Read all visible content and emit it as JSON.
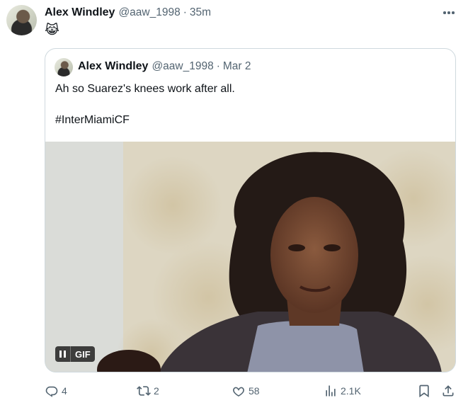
{
  "tweet": {
    "author_name": "Alex Windley",
    "handle": "@aaw_1998",
    "separator": "·",
    "time": "35m",
    "emoji": "😹",
    "quote": {
      "author_name": "Alex Windley",
      "handle": "@aaw_1998",
      "separator": "·",
      "time": "Mar 2",
      "text": "Ah so Suarez's knees work after all.",
      "hashtag": "#InterMiamiCF",
      "media_badge": "GIF"
    },
    "actions": {
      "replies": "4",
      "reposts": "2",
      "likes": "58",
      "views": "2.1K"
    }
  },
  "icons": {
    "more": "more-horizontal-icon",
    "reply": "reply-icon",
    "repost": "repost-icon",
    "like": "heart-icon",
    "views": "views-chart-icon",
    "bookmark": "bookmark-icon",
    "share": "share-icon",
    "pause": "pause-icon"
  },
  "colors": {
    "text": "#0f1419",
    "secondary": "#536471",
    "border": "#cfd9de"
  }
}
